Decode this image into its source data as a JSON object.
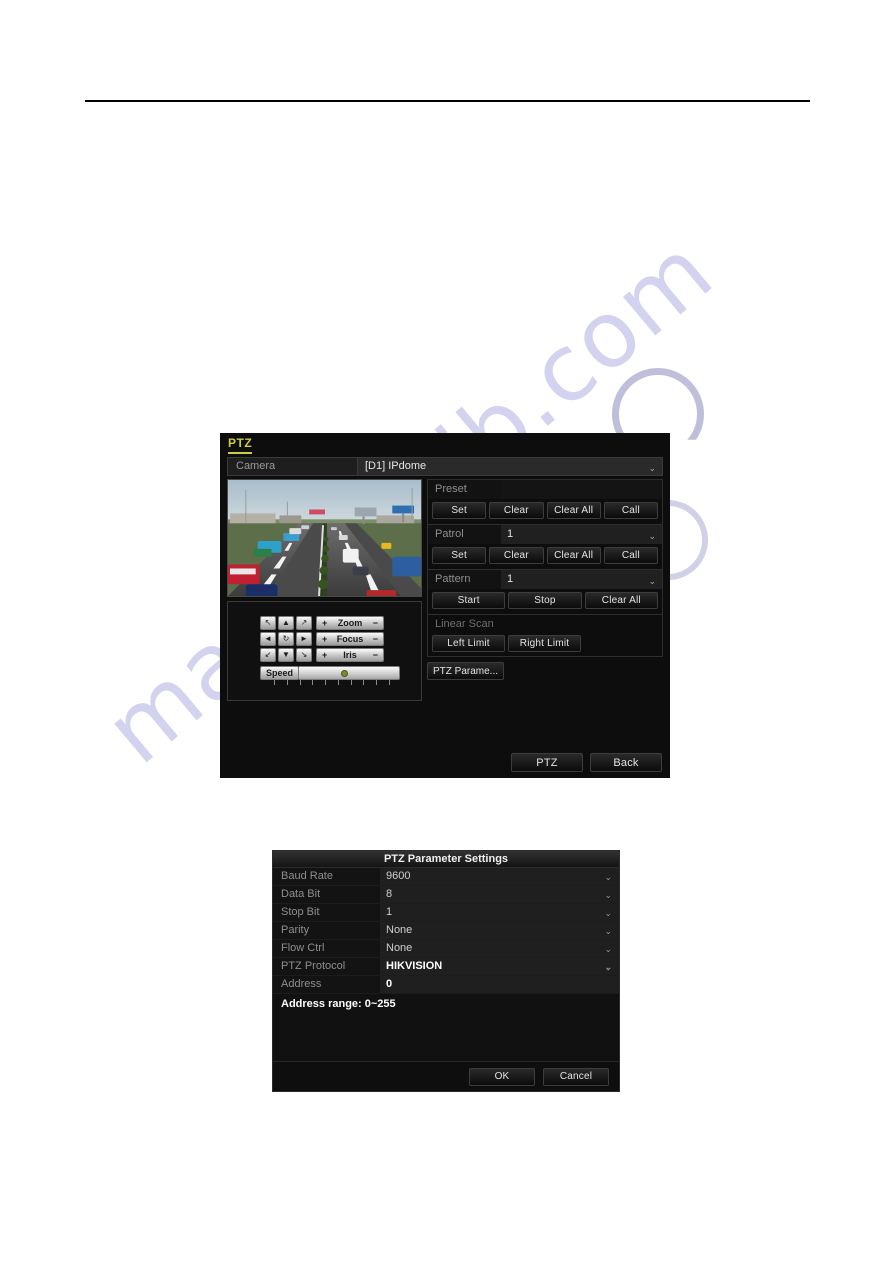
{
  "watermark": {
    "text": "manualslib.com"
  },
  "ptz_panel": {
    "title": "PTZ",
    "camera": {
      "label": "Camera",
      "value": "[D1] IPdome",
      "caret": "⌄"
    },
    "preset": {
      "label": "Preset",
      "value": "",
      "buttons": [
        "Set",
        "Clear",
        "Clear All",
        "Call"
      ]
    },
    "patrol": {
      "label": "Patrol",
      "value": "1",
      "caret": "⌄",
      "buttons": [
        "Set",
        "Clear",
        "Clear All",
        "Call"
      ]
    },
    "pattern": {
      "label": "Pattern",
      "value": "1",
      "caret": "⌄",
      "buttons": [
        "Start",
        "Stop",
        "Clear All"
      ]
    },
    "linear_scan": {
      "label": "Linear Scan",
      "buttons": [
        "Left Limit",
        "Right Limit"
      ]
    },
    "ptz_parameter_button": "PTZ Parame...",
    "controls": {
      "dpad": [
        "↖",
        "▲",
        "↗",
        "◄",
        "↻",
        "►",
        "↙",
        "▼",
        "↘"
      ],
      "lens": [
        {
          "name": "Zoom",
          "plus": "+",
          "minus": "−"
        },
        {
          "name": "Focus",
          "plus": "+",
          "minus": "−"
        },
        {
          "name": "Iris",
          "plus": "+",
          "minus": "−"
        }
      ],
      "speed_label": "Speed",
      "speed_value": 42
    },
    "footer_buttons": [
      "PTZ",
      "Back"
    ]
  },
  "param_dialog": {
    "title": "PTZ Parameter Settings",
    "rows": [
      {
        "key": "Baud Rate",
        "value": "9600",
        "caret": "⌄",
        "strong": false
      },
      {
        "key": "Data Bit",
        "value": "8",
        "caret": "⌄",
        "strong": false
      },
      {
        "key": "Stop Bit",
        "value": "1",
        "caret": "⌄",
        "strong": false
      },
      {
        "key": "Parity",
        "value": "None",
        "caret": "⌄",
        "strong": false
      },
      {
        "key": "Flow Ctrl",
        "value": "None",
        "caret": "⌄",
        "strong": false
      },
      {
        "key": "PTZ Protocol",
        "value": "HIKVISION",
        "caret": "⌄",
        "strong": true
      },
      {
        "key": "Address",
        "value": "0",
        "caret": "",
        "strong": true
      }
    ],
    "note": "Address range: 0~255",
    "footer_buttons": [
      "OK",
      "Cancel"
    ]
  },
  "colors": {
    "accent_yellow": "#c9cc44",
    "panel_bg": "#0d0d0d",
    "watermark": "#d3d3f0"
  }
}
